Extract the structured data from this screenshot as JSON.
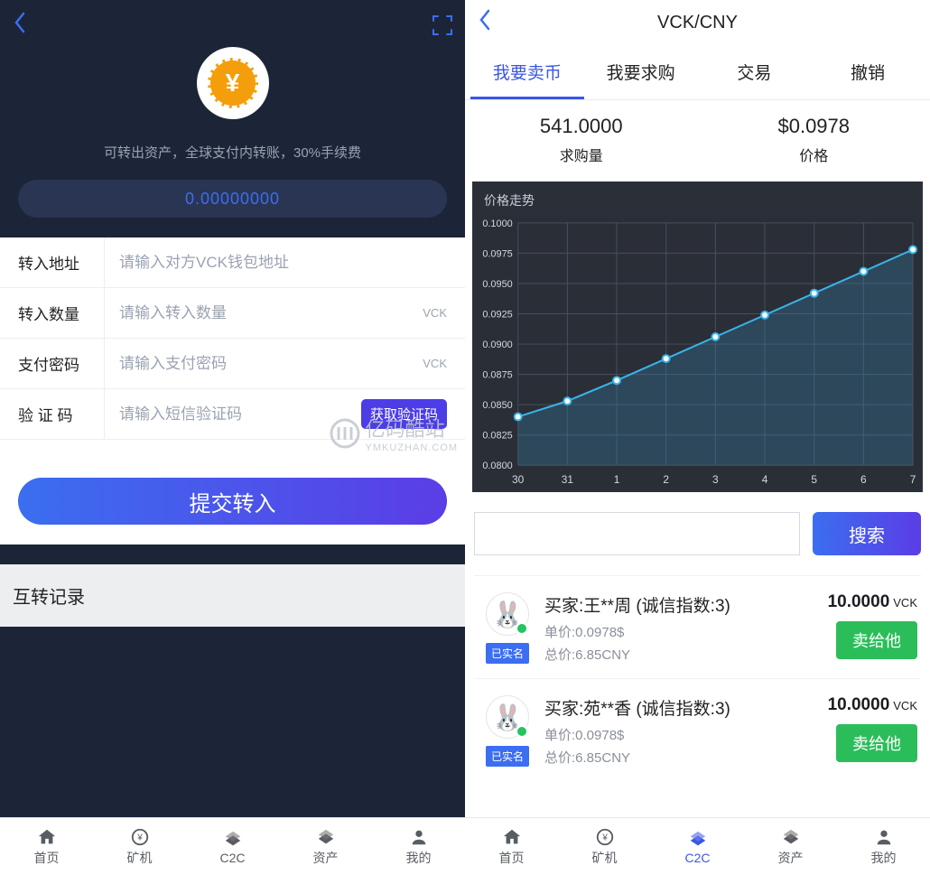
{
  "left": {
    "asset_note": "可转出资产，全球支付内转账，30%手续费",
    "balance": "0.00000000",
    "form": {
      "address_label": "转入地址",
      "address_placeholder": "请输入对方VCK钱包地址",
      "amount_label": "转入数量",
      "amount_placeholder": "请输入转入数量",
      "amount_unit": "VCK",
      "pwd_label": "支付密码",
      "pwd_placeholder": "请输入支付密码",
      "pwd_unit": "VCK",
      "code_label": "验 证 码",
      "code_placeholder": "请输入短信验证码",
      "get_code": "获取验证码"
    },
    "submit": "提交转入",
    "records_title": "互转记录",
    "watermark": {
      "main": "亿码酷站",
      "sub": "YMKUZHAN.COM"
    }
  },
  "right": {
    "title": "VCK/CNY",
    "tabs": [
      {
        "label": "我要卖币",
        "active": true
      },
      {
        "label": "我要求购",
        "active": false
      },
      {
        "label": "交易",
        "active": false
      },
      {
        "label": "撤销",
        "active": false
      }
    ],
    "stats": {
      "demand_value": "541.0000",
      "demand_label": "求购量",
      "price_value": "$0.0978",
      "price_label": "价格"
    },
    "chart_title": "价格走势",
    "search_btn": "搜索",
    "verified_badge": "已实名",
    "sell_btn": "卖给他",
    "listings": [
      {
        "buyer": "买家:王**周  (诚信指数:3)",
        "unit_price": "单价:0.0978$",
        "total": "总价:6.85CNY",
        "amount": "10.0000",
        "unit": "VCK"
      },
      {
        "buyer": "买家:苑**香  (诚信指数:3)",
        "unit_price": "单价:0.0978$",
        "total": "总价:6.85CNY",
        "amount": "10.0000",
        "unit": "VCK"
      }
    ]
  },
  "tabbar": [
    "首页",
    "矿机",
    "C2C",
    "资产",
    "我的"
  ],
  "chart_data": {
    "type": "line",
    "title": "价格走势",
    "x": [
      "30",
      "31",
      "1",
      "2",
      "3",
      "4",
      "5",
      "6",
      "7"
    ],
    "values": [
      0.084,
      0.0853,
      0.087,
      0.0888,
      0.0906,
      0.0924,
      0.0942,
      0.096,
      0.0978
    ],
    "ylim": [
      0.08,
      0.1
    ],
    "yticks": [
      0.08,
      0.0825,
      0.085,
      0.0875,
      0.09,
      0.0925,
      0.095,
      0.0975,
      0.1
    ]
  }
}
